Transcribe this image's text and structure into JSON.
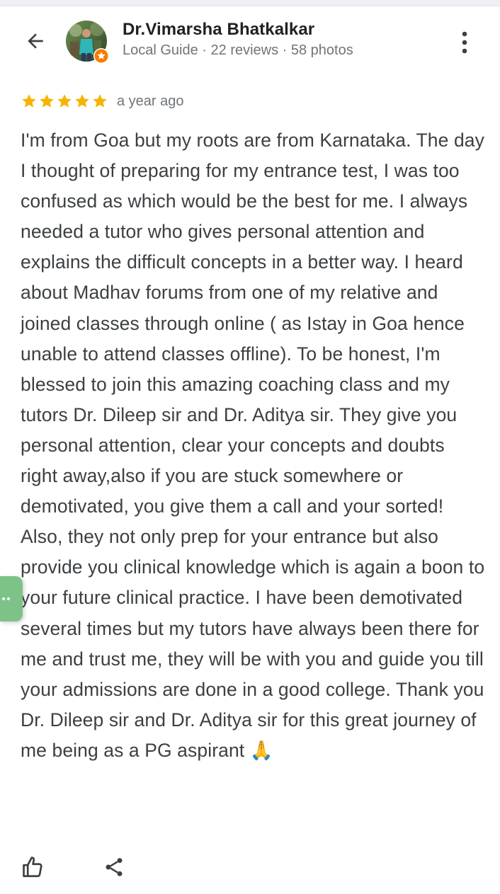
{
  "reviewer": {
    "name": "Dr.Vimarsha Bhatkalkar",
    "meta": "Local Guide · 22 reviews · 58 photos"
  },
  "rating": {
    "stars": 5,
    "star_color": "#f4b400",
    "time_ago": "a year ago"
  },
  "review": {
    "text": "I'm from Goa but my roots are from Karnataka. The day I thought of preparing for my entrance test, I was too confused as which would be the best for me. I always needed a tutor who gives personal attention and explains the difficult concepts in a better way. I heard about Madhav forums from one of my relative and joined classes through online ( as Istay in Goa hence unable to attend classes offline). To be honest, I'm blessed to join this amazing coaching class and my tutors Dr. Dileep sir and Dr. Aditya sir. They give you personal attention, clear your concepts and doubts right away,also if you are stuck somewhere or demotivated, you give them a call and your sorted! Also, they not only prep for your entrance but also provide you clinical knowledge which is again a boon to your future clinical practice. I have been demotivated several times but my tutors have always been there for me and trust me, they will be with you and guide you till your admissions are done in a good college. Thank you Dr. Dileep sir and Dr. Aditya sir for this great journey of me being as a PG aspirant 🙏"
  },
  "icons": {
    "back": "arrow-back-icon",
    "more": "more-vertical-icon",
    "badge": "local-guide-star-icon",
    "like": "thumb-up-icon",
    "share": "share-icon"
  },
  "colors": {
    "text_primary": "#202124",
    "text_body": "#3c4043",
    "text_secondary": "#70757a",
    "badge": "#f57c00",
    "side_tab": "#7dc387"
  }
}
